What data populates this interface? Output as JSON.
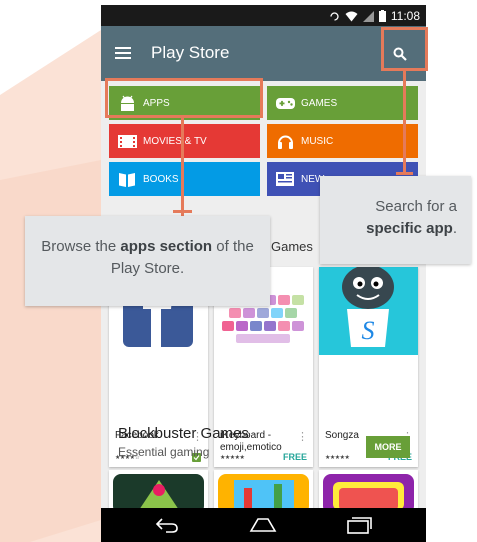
{
  "status_bar": {
    "time": "11:08"
  },
  "app_bar": {
    "title": "Play Store",
    "menu_icon": "menu-icon",
    "search_icon": "search-icon"
  },
  "categories": [
    {
      "label": "APPS",
      "color": "#689f38",
      "icon": "android-icon"
    },
    {
      "label": "GAMES",
      "color": "#689f38",
      "icon": "gamepad-icon"
    },
    {
      "label": "MOVIES & TV",
      "color": "#e53935",
      "icon": "film-icon"
    },
    {
      "label": "MUSIC",
      "color": "#ef6c00",
      "icon": "headphones-icon"
    },
    {
      "label": "BOOKS",
      "color": "#039be5",
      "icon": "book-icon"
    },
    {
      "label": "NEW",
      "color": "#3f51b5",
      "icon": "newspaper-icon"
    }
  ],
  "partial_section_title": "Games",
  "apps": [
    {
      "name": "Facebook",
      "price": "",
      "stars": "★★★★☆"
    },
    {
      "name": "iKeyboard - emoji,emotico",
      "price": "FREE",
      "stars": "★★★★★"
    },
    {
      "name": "Songza",
      "price": "FREE",
      "stars": "★★★★★"
    }
  ],
  "blockbuster": {
    "title": "Blockbuster Games",
    "subtitle": "Essential gaming",
    "more_label": "MORE"
  },
  "callouts": {
    "browse": {
      "pre": "Browse the ",
      "bold": "apps section",
      "post": " of the Play Store."
    },
    "search": {
      "pre": "Search for a ",
      "bold": "specific app",
      "post": "."
    }
  },
  "colors": {
    "highlight": "#e57a5a",
    "app_bar": "#546e7a",
    "callout_bg": "#e4e6e8"
  }
}
